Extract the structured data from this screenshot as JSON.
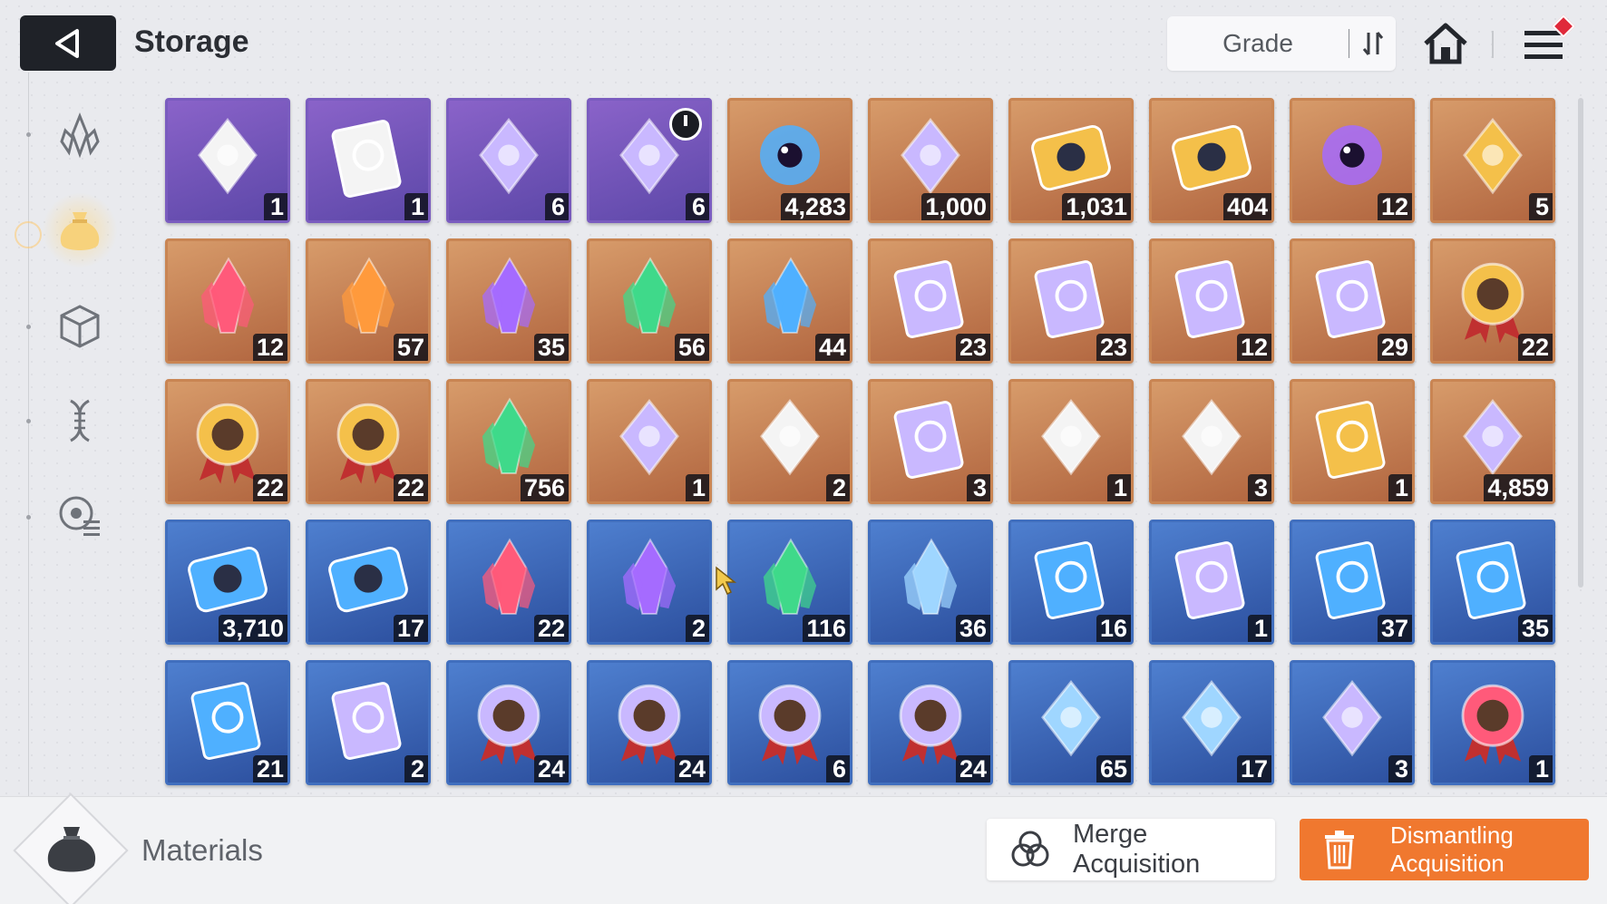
{
  "header": {
    "title": "Storage",
    "sort_label": "Grade"
  },
  "rail": {
    "items": [
      {
        "name": "rail-item-equipment",
        "icon": "crystal-shards-icon"
      },
      {
        "name": "rail-item-materials",
        "icon": "pouch-icon",
        "active": true
      },
      {
        "name": "rail-item-boxes",
        "icon": "cube-icon"
      },
      {
        "name": "rail-item-genes",
        "icon": "dna-icon"
      },
      {
        "name": "rail-item-skills",
        "icon": "target-list-icon"
      }
    ]
  },
  "items": [
    {
      "icon": "ornate-card-icon",
      "grade": "purple",
      "count": "1"
    },
    {
      "icon": "manual-book-icon",
      "grade": "purple",
      "count": "1"
    },
    {
      "icon": "rock-core-icon",
      "grade": "purple",
      "count": "6"
    },
    {
      "icon": "pyramid-module-icon",
      "grade": "purple",
      "count": "6",
      "timer": true
    },
    {
      "icon": "blue-eye-orb-icon",
      "grade": "orange",
      "count": "4,283"
    },
    {
      "icon": "chip-plate-icon",
      "grade": "orange",
      "count": "1,000"
    },
    {
      "icon": "gold-id-ticket-icon",
      "grade": "orange",
      "count": "1,031"
    },
    {
      "icon": "gold-star-ticket-icon",
      "grade": "orange",
      "count": "404"
    },
    {
      "icon": "purple-eye-orb-icon",
      "grade": "orange",
      "count": "12"
    },
    {
      "icon": "moon-sparkle-icon",
      "grade": "orange",
      "count": "5"
    },
    {
      "icon": "red-crystal-icon",
      "grade": "orange",
      "count": "12"
    },
    {
      "icon": "amber-crystal-icon",
      "grade": "orange",
      "count": "57"
    },
    {
      "icon": "violet-crystal-icon",
      "grade": "orange",
      "count": "35"
    },
    {
      "icon": "green-crystal-icon",
      "grade": "orange",
      "count": "56"
    },
    {
      "icon": "blue-crystal-icon",
      "grade": "orange",
      "count": "44"
    },
    {
      "icon": "sword-tome-icon",
      "grade": "orange",
      "count": "23"
    },
    {
      "icon": "target-tome-icon",
      "grade": "orange",
      "count": "23"
    },
    {
      "icon": "wing-tome-icon",
      "grade": "orange",
      "count": "12"
    },
    {
      "icon": "bolt-tome-icon",
      "grade": "orange",
      "count": "29"
    },
    {
      "icon": "sword-medal-icon",
      "grade": "orange",
      "count": "22"
    },
    {
      "icon": "target-medal-icon",
      "grade": "orange",
      "count": "22"
    },
    {
      "icon": "bolt-medal-icon",
      "grade": "orange",
      "count": "22"
    },
    {
      "icon": "green-shards-icon",
      "grade": "orange",
      "count": "756"
    },
    {
      "icon": "prism-gem-icon",
      "grade": "orange",
      "count": "1"
    },
    {
      "icon": "sneakers-icon",
      "grade": "orange",
      "count": "2"
    },
    {
      "icon": "star-map-book-icon",
      "grade": "orange",
      "count": "3"
    },
    {
      "icon": "card-deck-icon",
      "grade": "orange",
      "count": "1"
    },
    {
      "icon": "sealed-letter-icon",
      "grade": "orange",
      "count": "3"
    },
    {
      "icon": "gold-manual-icon",
      "grade": "orange",
      "count": "1"
    },
    {
      "icon": "music-note-icon",
      "grade": "orange",
      "count": "4,859"
    },
    {
      "icon": "blue-id-ticket-icon",
      "grade": "blue",
      "count": "3,710"
    },
    {
      "icon": "blue-star-ticket-icon",
      "grade": "blue",
      "count": "17"
    },
    {
      "icon": "red-shard-icon",
      "grade": "blue",
      "count": "22"
    },
    {
      "icon": "purple-shard-icon",
      "grade": "blue",
      "count": "2"
    },
    {
      "icon": "green-shard-icon",
      "grade": "blue",
      "count": "116"
    },
    {
      "icon": "ice-shard-icon",
      "grade": "blue",
      "count": "36"
    },
    {
      "icon": "sword-tome-blue-icon",
      "grade": "blue",
      "count": "16"
    },
    {
      "icon": "shield-tome-icon",
      "grade": "blue",
      "count": "1"
    },
    {
      "icon": "target-tome-blue-icon",
      "grade": "blue",
      "count": "37"
    },
    {
      "icon": "wing-tome-blue-icon",
      "grade": "blue",
      "count": "35"
    },
    {
      "icon": "bolt-tome-blue-icon",
      "grade": "blue",
      "count": "21"
    },
    {
      "icon": "rune-tome-icon",
      "grade": "blue",
      "count": "2"
    },
    {
      "icon": "sword-badge-icon",
      "grade": "blue",
      "count": "24"
    },
    {
      "icon": "target-badge-icon",
      "grade": "blue",
      "count": "24"
    },
    {
      "icon": "wing-badge-icon",
      "grade": "blue",
      "count": "6"
    },
    {
      "icon": "bolt-badge-icon",
      "grade": "blue",
      "count": "24"
    },
    {
      "icon": "ice-flower-gem-icon",
      "grade": "blue",
      "count": "65"
    },
    {
      "icon": "cake-slice-icon",
      "grade": "blue",
      "count": "17"
    },
    {
      "icon": "pocket-watch-icon",
      "grade": "blue",
      "count": "3"
    },
    {
      "icon": "red-star-medal-icon",
      "grade": "blue",
      "count": "1"
    }
  ],
  "footer": {
    "category_label": "Materials",
    "merge_label": "Merge Acquisition",
    "dismantle_label": "Dismantling Acquisition"
  },
  "colors": {
    "purple_grade": "#6b52b6",
    "orange_grade": "#c27a4b",
    "blue_grade": "#3762b2",
    "accent_orange": "#f0782f"
  }
}
